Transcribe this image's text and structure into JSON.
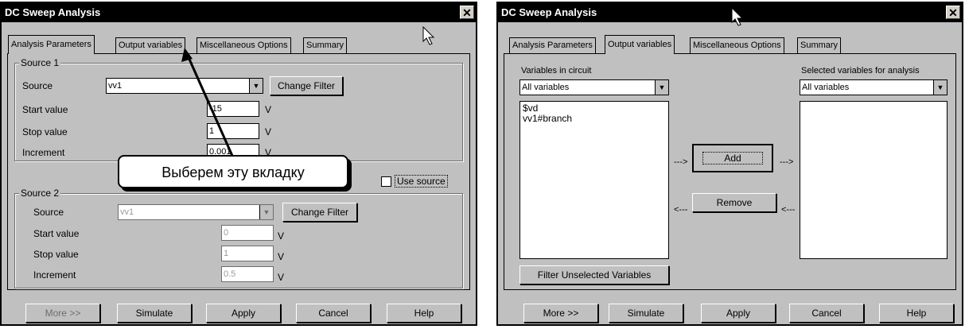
{
  "left": {
    "title": "DC Sweep Analysis",
    "close_symbol": "✕",
    "tabs": [
      "Analysis Parameters",
      "Output variables",
      "Miscellaneous Options",
      "Summary"
    ],
    "source1": {
      "group_label": "Source 1",
      "source_label": "Source",
      "source_value": "vv1",
      "change_filter": "Change Filter",
      "start_label": "Start value",
      "start_value": "-15",
      "stop_label": "Stop value",
      "stop_value": "1",
      "increment_label": "Increment",
      "increment_value": "0.001",
      "unit": "V"
    },
    "use_source": "Use source",
    "source2": {
      "group_label": "Source 2",
      "source_label": "Source",
      "source_value": "vv1",
      "change_filter": "Change Filter",
      "start_label": "Start value",
      "start_value": "0",
      "stop_label": "Stop value",
      "stop_value": "1",
      "increment_label": "Increment",
      "increment_value": "0.5",
      "unit": "V"
    },
    "buttons": {
      "more": "More >>",
      "simulate": "Simulate",
      "apply": "Apply",
      "cancel": "Cancel",
      "help": "Help"
    },
    "callout": "Выберем эту вкладку"
  },
  "right": {
    "title": "DC Sweep Analysis",
    "close_symbol": "✕",
    "tabs": [
      "Analysis Parameters",
      "Output variables",
      "Miscellaneous Options",
      "Summary"
    ],
    "vars_label": "Variables in circuit",
    "vars_filter": "All variables",
    "vars_list": [
      "$vd",
      "vv1#branch"
    ],
    "selected_label": "Selected variables for analysis",
    "selected_filter": "All variables",
    "add_button": "Add",
    "remove_button": "Remove",
    "arrow_right": "--->",
    "arrow_left": "<---",
    "filter_unselected": "Filter Unselected Variables",
    "buttons": {
      "more": "More >>",
      "simulate": "Simulate",
      "apply": "Apply",
      "cancel": "Cancel",
      "help": "Help"
    }
  }
}
